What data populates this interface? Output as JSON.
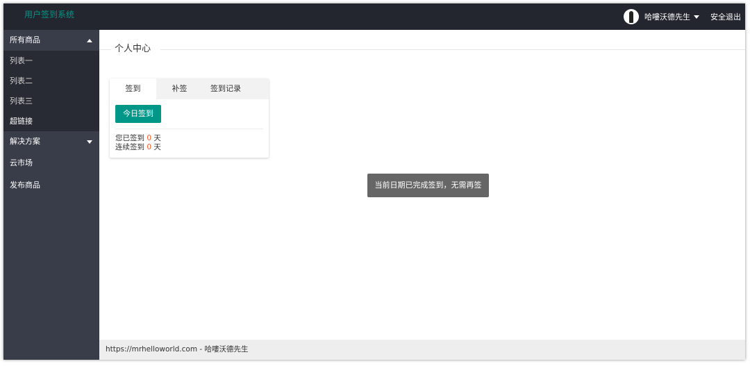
{
  "header": {
    "logo": "用户签到系统",
    "user_name": "哈嘍沃德先生",
    "logout": "安全退出"
  },
  "sidebar": {
    "groups": [
      {
        "label": "所有商品",
        "expanded": true,
        "items": [
          "列表一",
          "列表二",
          "列表三",
          "超链接"
        ]
      },
      {
        "label": "解决方案",
        "expanded": false
      }
    ],
    "items": [
      "云市场",
      "发布商品"
    ]
  },
  "main": {
    "section_title": "个人中心",
    "tabs": [
      "签到",
      "补签",
      "签到记录"
    ],
    "sign_button": "今日签到",
    "stats": {
      "total_prefix": "您已签到",
      "total_value": "0",
      "total_suffix": "天",
      "streak_prefix": "连续签到",
      "streak_value": "0",
      "streak_suffix": "天"
    },
    "toast": "当前日期已完成签到，无需再签"
  },
  "footer": {
    "text": "https://mrhelloworld.com - 哈嘍沃德先生"
  },
  "colors": {
    "header_bg": "#23262e",
    "sidebar_bg": "#393d49",
    "sidebar_sub_bg": "#282b33",
    "accent": "#009688",
    "number_highlight": "#ff5722",
    "toast_bg": "#666666",
    "footer_bg": "#eeeeee"
  },
  "icons": {
    "avatar": "avatar",
    "user_menu": "caret-down-icon",
    "group_expanded": "caret-up-icon",
    "group_collapsed": "caret-down-icon"
  }
}
